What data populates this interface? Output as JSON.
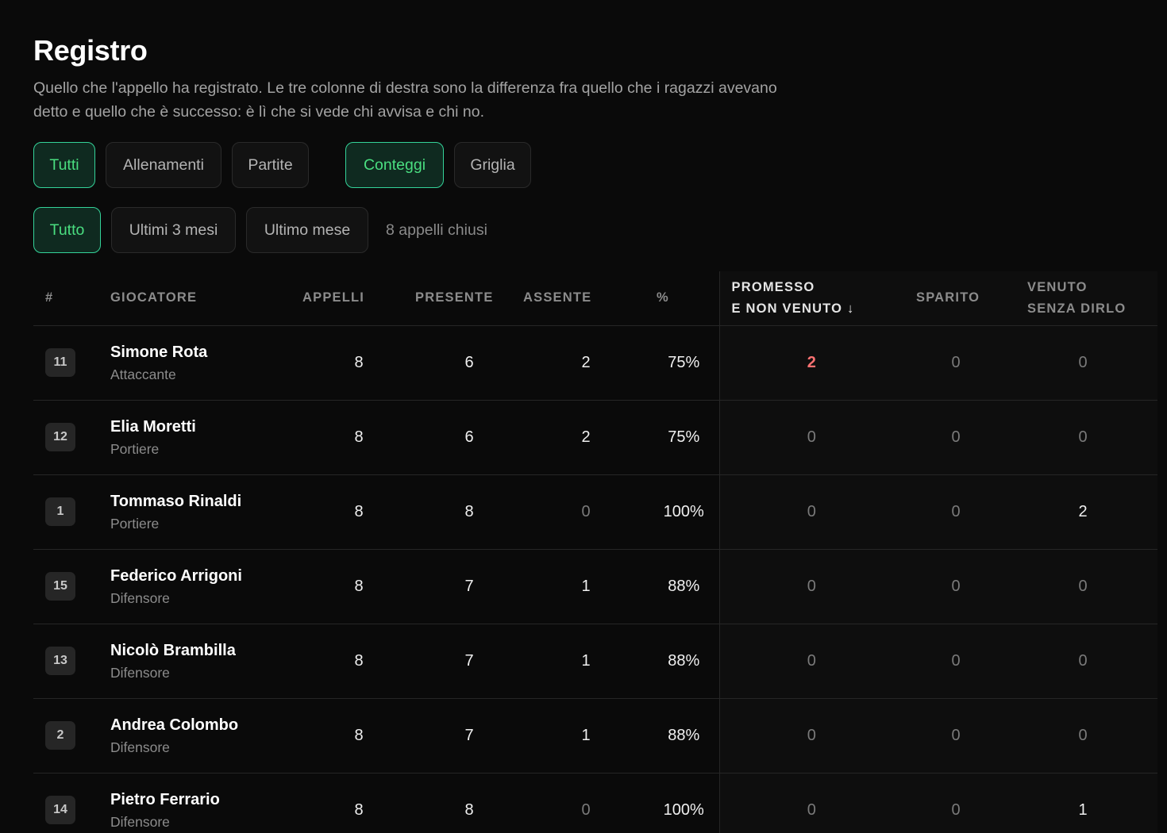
{
  "title": "Registro",
  "subtitle": "Quello che l'appello ha registrato. Le tre colonne di destra sono la differenza fra quello che i ragazzi avevano detto e quello che è successo: è lì che si vede chi avvisa e chi no.",
  "filters": {
    "type": [
      "Tutti",
      "Allenamenti",
      "Partite"
    ],
    "type_active": "Tutti",
    "view": [
      "Conteggi",
      "Griglia"
    ],
    "view_active": "Conteggi",
    "period": [
      "Tutto",
      "Ultimi 3 mesi",
      "Ultimo mese"
    ],
    "period_active": "Tutto",
    "closed_count_label": "8 appelli chiusi"
  },
  "table": {
    "headers": {
      "num": "#",
      "player": "GIOCATORE",
      "calls": "APPELLI",
      "present": "PRESENTE",
      "absent": "ASSENTE",
      "pct": "%",
      "promised_line1": "PROMESSO",
      "promised_line2": "E NON VENUTO ↓",
      "vanished": "SPARITO",
      "came_line1": "VENUTO",
      "came_line2": "SENZA DIRLO"
    },
    "rows": [
      {
        "num": "11",
        "name": "Simone Rota",
        "role": "Attaccante",
        "calls": "8",
        "present": "6",
        "absent": "2",
        "pct": "75%",
        "promised": "2",
        "vanished": "0",
        "came": "0"
      },
      {
        "num": "12",
        "name": "Elia Moretti",
        "role": "Portiere",
        "calls": "8",
        "present": "6",
        "absent": "2",
        "pct": "75%",
        "promised": "0",
        "vanished": "0",
        "came": "0"
      },
      {
        "num": "1",
        "name": "Tommaso Rinaldi",
        "role": "Portiere",
        "calls": "8",
        "present": "8",
        "absent": "0",
        "pct": "100%",
        "promised": "0",
        "vanished": "0",
        "came": "2"
      },
      {
        "num": "15",
        "name": "Federico Arrigoni",
        "role": "Difensore",
        "calls": "8",
        "present": "7",
        "absent": "1",
        "pct": "88%",
        "promised": "0",
        "vanished": "0",
        "came": "0"
      },
      {
        "num": "13",
        "name": "Nicolò Brambilla",
        "role": "Difensore",
        "calls": "8",
        "present": "7",
        "absent": "1",
        "pct": "88%",
        "promised": "0",
        "vanished": "0",
        "came": "0"
      },
      {
        "num": "2",
        "name": "Andrea Colombo",
        "role": "Difensore",
        "calls": "8",
        "present": "7",
        "absent": "1",
        "pct": "88%",
        "promised": "0",
        "vanished": "0",
        "came": "0"
      },
      {
        "num": "14",
        "name": "Pietro Ferrario",
        "role": "Difensore",
        "calls": "8",
        "present": "8",
        "absent": "0",
        "pct": "100%",
        "promised": "0",
        "vanished": "0",
        "came": "1"
      }
    ]
  },
  "colors": {
    "background": "#0a0a0a",
    "accent_green": "#4ade80",
    "alert_red": "#f87171"
  }
}
